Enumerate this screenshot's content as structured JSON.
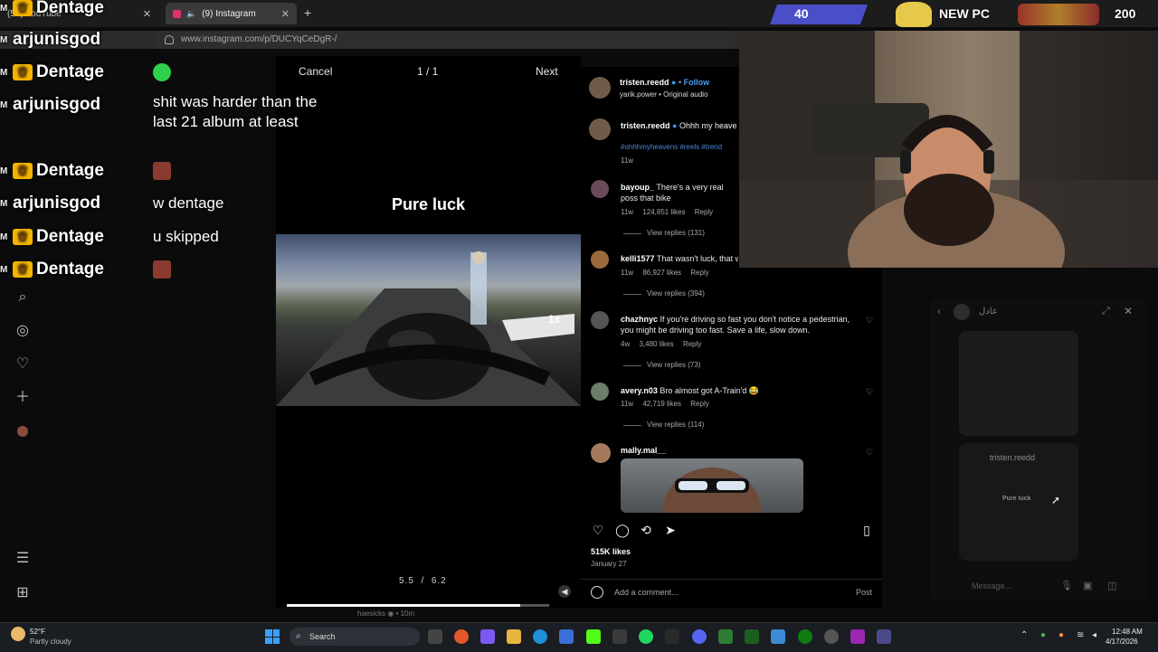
{
  "browser": {
    "tabs": [
      {
        "label": "(57) YouTube"
      },
      {
        "label": "(9) Instagram"
      }
    ],
    "url": "www.instagram.com/p/DUCYqCeDgR-/"
  },
  "chat": {
    "messages": [
      {
        "user": "Dentage",
        "text": ""
      },
      {
        "user": "arjunisgod",
        "text": ""
      },
      {
        "user": "Dentage",
        "text": ""
      },
      {
        "user": "arjunisgod",
        "text": "shit was harder than the last 21 album at least"
      },
      {
        "user": "Dentage",
        "text": ""
      },
      {
        "user": "arjunisgod",
        "text": "w dentage"
      },
      {
        "user": "Dentage",
        "text": "u skipped"
      },
      {
        "user": "Dentage",
        "text": ""
      }
    ]
  },
  "reel": {
    "cancel_label": "Cancel",
    "page_count": "1 / 1",
    "next_label": "Next",
    "caption": "Pure luck",
    "speed": "1x",
    "time_current": "5.5",
    "time_total": "6.2",
    "progress_fraction": 0.89,
    "bottom_user": "haesicks",
    "bottom_time": "10m"
  },
  "post": {
    "author": "tristen.reedd",
    "follow_label": "Follow",
    "audio": "yarik.power • Original audio",
    "caption_text": "Ohhh my heave",
    "hashtags": "#ohhhmyheavens #reels #trend",
    "caption_age": "11w",
    "likes": "515K likes",
    "date": "January 27",
    "comment_placeholder": "Add a comment...",
    "post_label": "Post"
  },
  "comments": [
    {
      "user": "bayoup_",
      "text": "There's a very real poss that bike",
      "age": "11w",
      "likes": "124,851 likes",
      "reply": "Reply",
      "view_replies": "View replies (131)"
    },
    {
      "user": "kelli1577",
      "text": "That wasn't luck, that w",
      "age": "11w",
      "likes": "86,927 likes",
      "reply": "Reply",
      "view_replies": "View replies (394)"
    },
    {
      "user": "chazhnyc",
      "text": "If you're driving so fast you don't notice a pedestrian, you might be driving too fast. Save a life, slow down.",
      "age": "4w",
      "likes": "3,480 likes",
      "reply": "Reply",
      "view_replies": "View replies (73)"
    },
    {
      "user": "avery.n03",
      "text": "Bro almost got A-Train'd 😂",
      "age": "11w",
      "likes": "42,719 likes",
      "reply": "Reply",
      "view_replies": "View replies (114)"
    },
    {
      "user": "mally.mal__",
      "text": ""
    }
  ],
  "stream": {
    "sub_goal": "40",
    "goal_title": "NEW PC",
    "goal_number": "200"
  },
  "dm": {
    "name": "عادل",
    "card_user": "tristen.reedd",
    "card_caption": "Pure luck",
    "message_placeholder": "Message..."
  },
  "taskbar": {
    "weather_temp": "52°F",
    "weather_desc": "Partly cloudy",
    "search_label": "Search",
    "time": "12:48 AM",
    "date": "4/17/2026"
  }
}
